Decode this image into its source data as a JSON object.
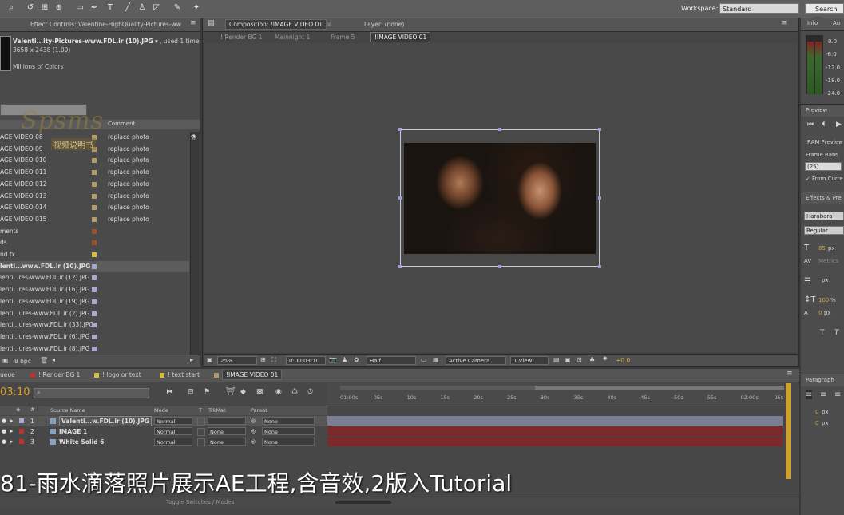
{
  "workspace": {
    "label": "Workspace:",
    "value": "Standard",
    "search_placeholder": "Search H"
  },
  "project": {
    "effect_controls_tab": "Effect Controls: Valentine-HighQuality-Pictures-ww",
    "file_name": "Valenti...ity-Pictures-www.FDL.ir (10).JPG",
    "used": "▾ , used 1 time",
    "dims": "3658 x 2438 (1.00)",
    "colors": "Millions of Colors",
    "comment_header": "Comment",
    "bpc": "8 bpc",
    "rows": [
      {
        "name": "AGE VIDEO 08",
        "comment": "replace photo",
        "color": "#b59a6a"
      },
      {
        "name": "AGE VIDEO 09",
        "comment": "replace photo",
        "color": "#b59a6a"
      },
      {
        "name": "AGE VIDEO 010",
        "comment": "replace photo",
        "color": "#b59a6a"
      },
      {
        "name": "AGE VIDEO 011",
        "comment": "replace photo",
        "color": "#b59a6a"
      },
      {
        "name": "AGE VIDEO 012",
        "comment": "replace photo",
        "color": "#b59a6a"
      },
      {
        "name": "AGE VIDEO 013",
        "comment": "replace photo",
        "color": "#b59a6a"
      },
      {
        "name": "AGE VIDEO 014",
        "comment": "replace photo",
        "color": "#b59a6a"
      },
      {
        "name": "AGE VIDEO 015",
        "comment": "replace photo",
        "color": "#b59a6a"
      },
      {
        "name": "ments",
        "comment": "",
        "color": "#a0522d"
      },
      {
        "name": "ds",
        "comment": "",
        "color": "#a0522d"
      },
      {
        "name": "nd fx",
        "comment": "",
        "color": "#d4c040"
      },
      {
        "name": "lenti...www.FDL.ir (10).JPG",
        "comment": "",
        "color": "#a8a8d0"
      },
      {
        "name": "lenti...res-www.FDL.ir (12).JPG",
        "comment": "",
        "color": "#a8a8d0"
      },
      {
        "name": "lenti...res-www.FDL.ir (16).JPG",
        "comment": "",
        "color": "#a8a8d0"
      },
      {
        "name": "lenti...res-www.FDL.ir (19).JPG",
        "comment": "",
        "color": "#a8a8d0"
      },
      {
        "name": "lenti...ures-www.FDL.ir (2).JPG",
        "comment": "",
        "color": "#a8a8d0"
      },
      {
        "name": "lenti...ures-www.FDL.ir (33).JPG",
        "comment": "",
        "color": "#a8a8d0"
      },
      {
        "name": "lenti...ures-www.FDL.ir (6).JPG",
        "comment": "",
        "color": "#a8a8d0"
      },
      {
        "name": "lenti...ures-www.FDL.ir (8).JPG",
        "comment": "",
        "color": "#a8a8d0"
      }
    ]
  },
  "composition": {
    "tab": "Composition: !IMAGE VIDEO 01",
    "layer_tab": "Layer: (none)",
    "crumbs": [
      "! Render BG 1",
      "Mainnight 1",
      "Frame 5",
      "!IMAGE VIDEO 01"
    ]
  },
  "viewer": {
    "zoom": "25%",
    "timecode": "0:00:03:10",
    "resolution": "Half",
    "camera": "Active Camera",
    "views": "1 View",
    "exposure": "+0.0"
  },
  "timeline": {
    "tabs": [
      "ueue",
      "! Render BG 1",
      "! logo or text",
      "! text start",
      "!IMAGE VIDEO 01"
    ],
    "current_time": "03:10",
    "headers": {
      "source": "Source Name",
      "mode": "Mode",
      "t": "T",
      "trkmat": "TrkMat",
      "parent": "Parent"
    },
    "layers": [
      {
        "num": "1",
        "name": "Valenti...w.FDL.ir (10).JPG",
        "mode": "Normal",
        "trkmat": "",
        "parent": "None"
      },
      {
        "num": "2",
        "name": "IMAGE 1",
        "mode": "Normal",
        "trkmat": "None",
        "parent": "None"
      },
      {
        "num": "3",
        "name": "White Solid 6",
        "mode": "Normal",
        "trkmat": "None",
        "parent": "None"
      }
    ],
    "ruler": [
      "01:00s",
      "05s",
      "10s",
      "15s",
      "20s",
      "25s",
      "30s",
      "35s",
      "40s",
      "45s",
      "50s",
      "55s",
      "02:00s",
      "05s"
    ],
    "toggle_label": "Toggle Switches / Modes"
  },
  "right_panel": {
    "info_tab": "Info",
    "audio_tab": "Au",
    "meter": [
      "0.0",
      "-6.0",
      "-12.0",
      "-18.0",
      "-24.0"
    ],
    "preview_tab": "Preview",
    "ram_preview": "RAM Preview",
    "frame_rate_label": "Frame Rate",
    "frame_rate": "(25)",
    "from_current": "From Curre",
    "effects_tab": "Effects & Pre",
    "font": "Harabara",
    "style": "Regular",
    "font_size": "85",
    "px": "px",
    "metrics": "Metrics",
    "scale": "100",
    "pct": "%",
    "baseline": "0",
    "paragraph_tab": "Paragraph",
    "indent_a": "0",
    "indent_b": "0"
  },
  "overlay": {
    "watermark": "Spsms",
    "watermark_sub": "视频说明书",
    "subtitle": "81-雨水滴落照片展示AE工程,含音效,2版入Tutorial"
  }
}
